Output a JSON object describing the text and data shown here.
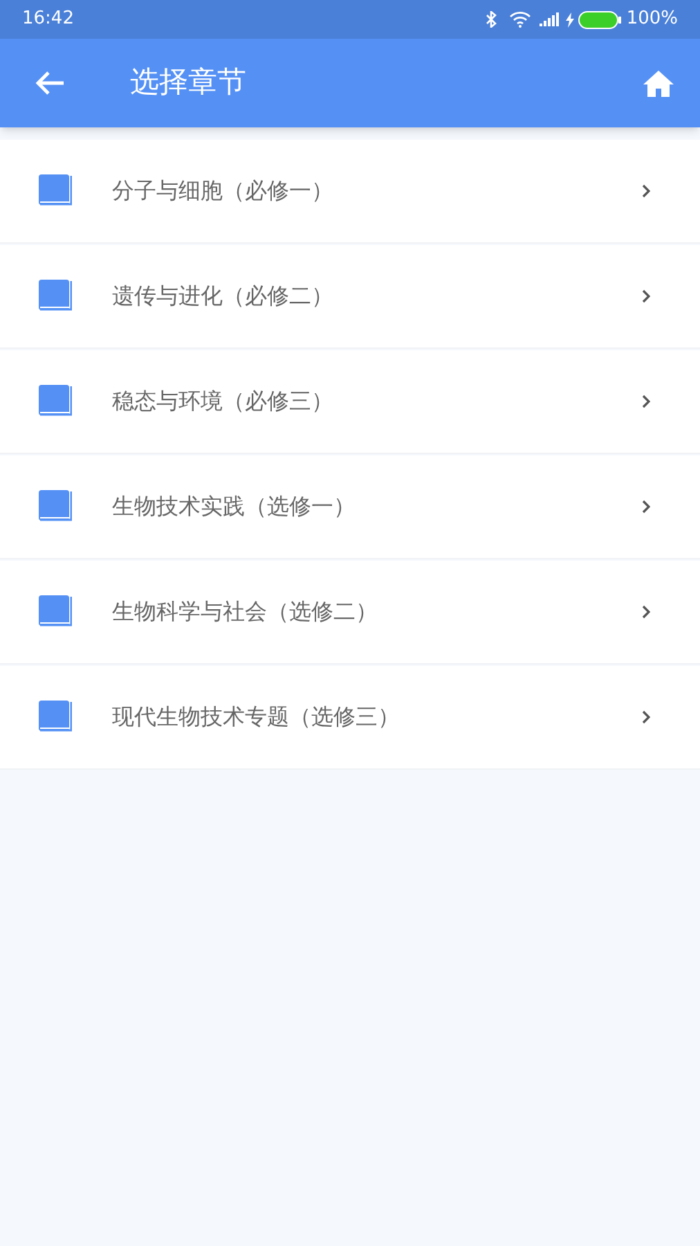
{
  "status_bar": {
    "time": "16:42",
    "battery_text": "100%"
  },
  "app_bar": {
    "title": "选择章节"
  },
  "chapters": [
    {
      "label": "分子与细胞（必修一）"
    },
    {
      "label": "遗传与进化（必修二）"
    },
    {
      "label": "稳态与环境（必修三）"
    },
    {
      "label": "生物技术实践（选修一）"
    },
    {
      "label": "生物科学与社会（选修二）"
    },
    {
      "label": "现代生物技术专题（选修三）"
    }
  ]
}
